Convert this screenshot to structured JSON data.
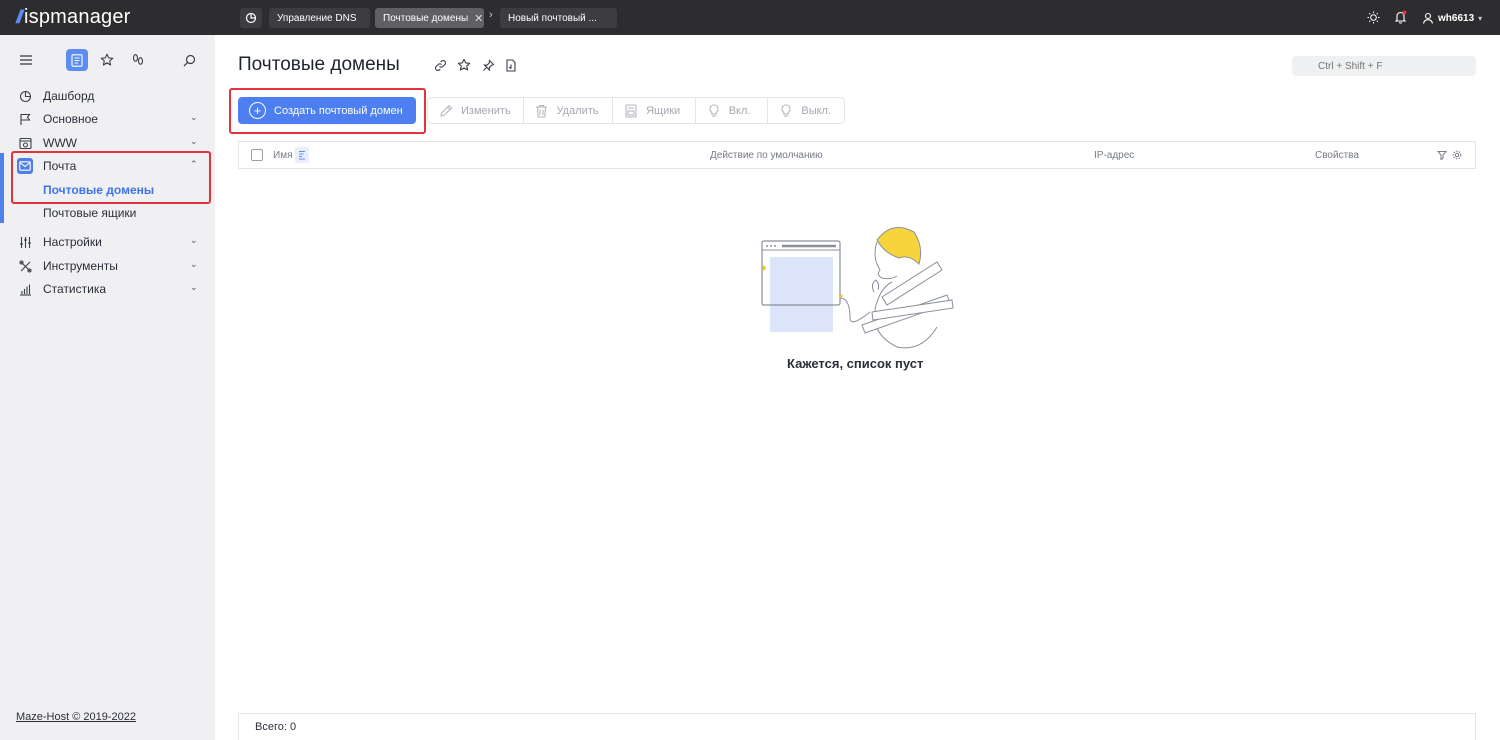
{
  "app": {
    "logo_text": "ispmanager",
    "user": "wh6613"
  },
  "tabs": [
    {
      "label": "Управление DNS"
    },
    {
      "label": "Почтовые домены"
    },
    {
      "label": "Новый почтовый ..."
    }
  ],
  "sidebar": {
    "items": [
      {
        "label": "Дашборд"
      },
      {
        "label": "Основное"
      },
      {
        "label": "WWW"
      },
      {
        "label": "Почта"
      },
      {
        "label": "Настройки"
      },
      {
        "label": "Инструменты"
      },
      {
        "label": "Статистика"
      }
    ],
    "sub_items": [
      {
        "label": "Почтовые домены"
      },
      {
        "label": "Почтовые ящики"
      }
    ],
    "footer": "Maze-Host © 2019-2022"
  },
  "page": {
    "title": "Почтовые домены",
    "search_placeholder": "Ctrl + Shift + F"
  },
  "toolbar": {
    "create": "Создать почтовый домен",
    "edit": "Изменить",
    "delete": "Удалить",
    "boxes": "Ящики",
    "on": "Вкл.",
    "off": "Выкл."
  },
  "table": {
    "columns": [
      "Имя",
      "Действие по умолчанию",
      "IP-адрес",
      "Свойства"
    ],
    "rows": [],
    "empty_message": "Кажется, список пуст"
  },
  "footer": {
    "total": "Всего: 0"
  },
  "colors": {
    "accent": "#4d7ff0",
    "highlight": "#e1343c",
    "topbar": "#2d2d30",
    "sidebar": "#f0f0f2"
  }
}
